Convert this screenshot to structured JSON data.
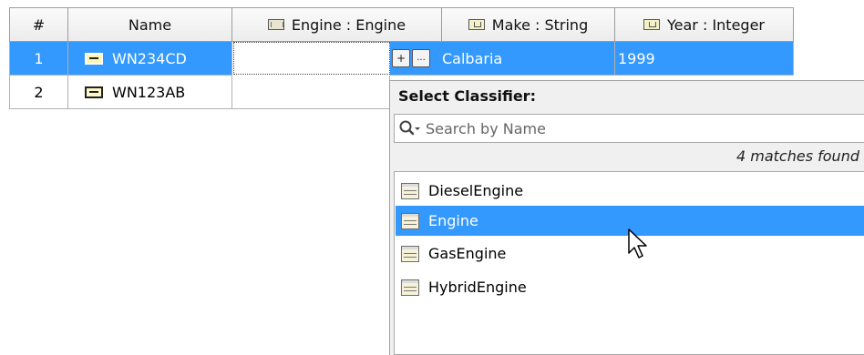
{
  "table": {
    "columns": [
      {
        "label": "#"
      },
      {
        "label": "Name"
      },
      {
        "label": "Engine : Engine",
        "icon": "classifier-icon"
      },
      {
        "label": "Make : String",
        "icon": "datatype-icon"
      },
      {
        "label": "Year : Integer",
        "icon": "datatype-icon"
      }
    ],
    "rows": [
      {
        "index": "1",
        "name": "WN234CD",
        "engine": "",
        "make": "Calbaria",
        "year": "1999",
        "selected": true
      },
      {
        "index": "2",
        "name": "WN123AB",
        "engine": "",
        "make": "",
        "year": "",
        "selected": false
      }
    ]
  },
  "editor": {
    "add_button_glyph": "+",
    "more_button_glyph": "..."
  },
  "popup": {
    "title": "Select Classifier:",
    "search_placeholder": "Search by Name",
    "search_icon": "magnifier-dropdown-icon",
    "matches_text": "4 matches found",
    "items": [
      {
        "label": "DieselEngine"
      },
      {
        "label": "Engine",
        "highlighted": true
      },
      {
        "label": "GasEngine"
      },
      {
        "label": "HybridEngine"
      }
    ]
  },
  "colors": {
    "selection": "#3399ff",
    "header_border": "#9c9c9c"
  }
}
